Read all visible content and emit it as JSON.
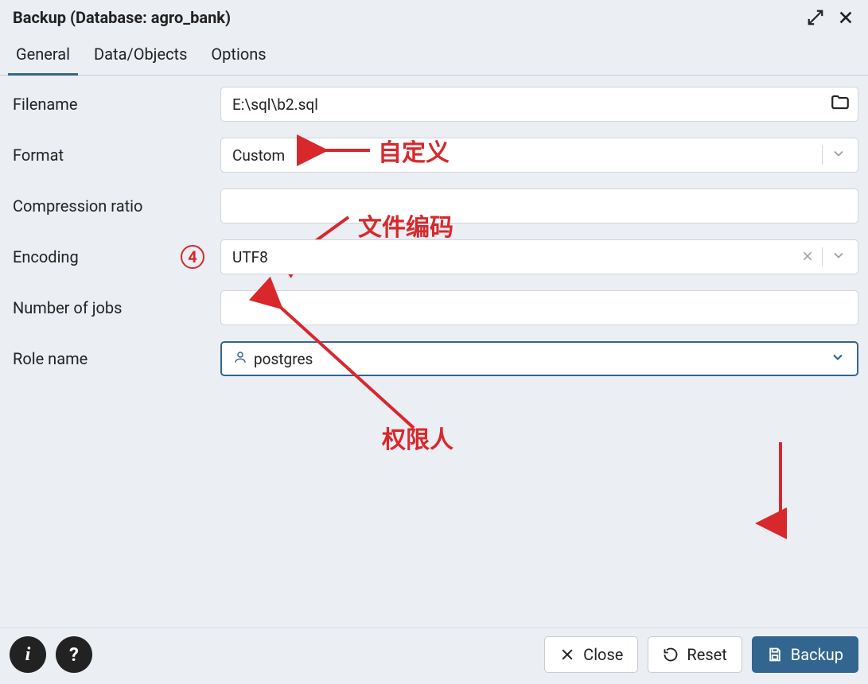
{
  "window": {
    "title": "Backup (Database: agro_bank)"
  },
  "tabs": {
    "general": "General",
    "data_objects": "Data/Objects",
    "options": "Options",
    "active": "general"
  },
  "labels": {
    "filename": "Filename",
    "format": "Format",
    "compression_ratio": "Compression ratio",
    "encoding": "Encoding",
    "number_of_jobs": "Number of jobs",
    "role_name": "Role name"
  },
  "fields": {
    "filename": "E:\\sql\\b2.sql",
    "format": "Custom",
    "compression_ratio": "",
    "encoding": "UTF8",
    "number_of_jobs": "",
    "role_name": "postgres"
  },
  "annotations": {
    "circled_number": "4",
    "format_note": "自定义",
    "encoding_note": "文件编码",
    "role_note": "权限人"
  },
  "footer": {
    "close": "Close",
    "reset": "Reset",
    "backup": "Backup"
  },
  "colors": {
    "accent": "#326690",
    "annotation": "#d8282c",
    "bg": "#ebeef3"
  }
}
